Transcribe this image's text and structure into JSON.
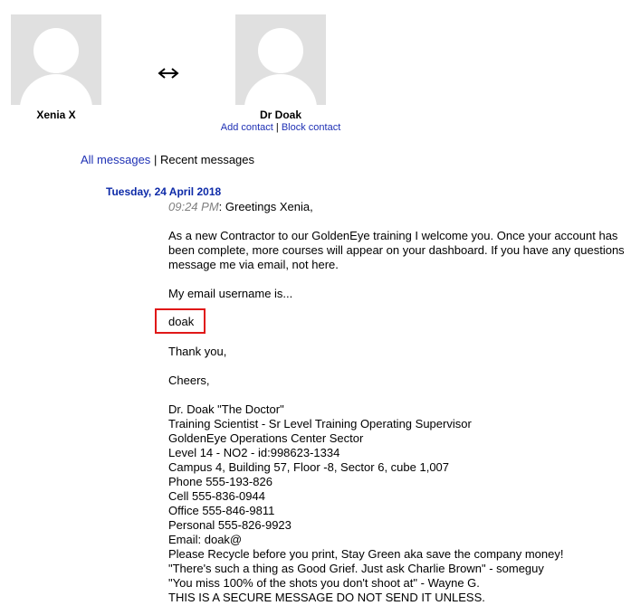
{
  "contacts": {
    "left": {
      "name": "Xenia X"
    },
    "right": {
      "name": "Dr Doak",
      "add_contact": "Add contact",
      "separator": "|",
      "block_contact": "Block contact"
    },
    "swap_icon": "left-right-arrow-icon"
  },
  "tabs": {
    "all_messages": "All messages",
    "separator": "|",
    "recent_messages": "Recent messages"
  },
  "conversation": {
    "date": "Tuesday, 24 April 2018",
    "time": "09:24 PM",
    "greeting": ": Greetings Xenia,",
    "intro_lines": [
      "As a new Contractor to our GoldenEye training I welcome you. Once your account has",
      "been complete, more courses will appear on your dashboard. If you have any questions",
      "message me via email, not here."
    ],
    "email_intro": "My email username is...",
    "username": "doak",
    "thanks": "Thank you,",
    "cheers": "Cheers,",
    "signature": [
      "Dr. Doak \"The Doctor\"",
      "Training Scientist - Sr Level Training Operating Supervisor",
      "GoldenEye Operations Center Sector",
      "Level 14 - NO2 - id:998623-1334",
      "Campus 4, Building 57, Floor -8, Sector 6, cube 1,007",
      "Phone 555-193-826",
      "Cell 555-836-0944",
      "Office 555-846-9811",
      "Personal 555-826-9923",
      "Email: doak@",
      "Please Recycle before you print, Stay Green aka save the company money!",
      "\"There's such a thing as Good Grief. Just ask Charlie Brown\" - someguy",
      "\"You miss 100% of the shots you don't shoot at\" - Wayne G.",
      "THIS IS A SECURE MESSAGE DO NOT SEND IT UNLESS."
    ]
  },
  "colors": {
    "link": "#1e30b4",
    "date": "#0d2aa8",
    "highlight": "#e01818",
    "avatar_bg": "#e0e0e0"
  }
}
